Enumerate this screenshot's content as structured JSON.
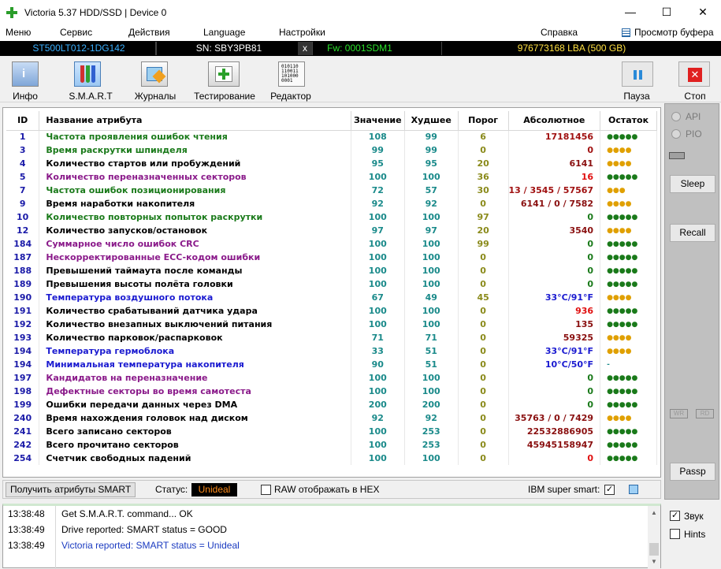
{
  "window": {
    "title": "Victoria 5.37 HDD/SSD | Device 0",
    "min": "—",
    "max": "☐",
    "close": "✕"
  },
  "menu": {
    "items": [
      "Меню",
      "Сервис",
      "Действия",
      "Language",
      "Настройки",
      "Справка"
    ],
    "buffer_viewer": "Просмотр буфера"
  },
  "device": {
    "model": "ST500LT012-1DG142",
    "serial": "SN: SBY3PB81",
    "x": "x",
    "firmware": "Fw: 0001SDM1",
    "lba": "976773168 LBA (500 GB)"
  },
  "toolbar": {
    "info": "Инфо",
    "smart": "S.M.A.R.T",
    "logs": "Журналы",
    "testing": "Тестирование",
    "editor": "Редактор",
    "pause": "Пауза",
    "stop": "Стоп"
  },
  "table": {
    "headers": {
      "id": "ID",
      "name": "Название атрибута",
      "value": "Значение",
      "worst": "Худшее",
      "threshold": "Порог",
      "absolute": "Абсолютное",
      "remain": "Остаток"
    },
    "rows": [
      {
        "id": "1",
        "name": "Частота проявления ошибок чтения",
        "value": "108",
        "worst": "99",
        "thr": "6",
        "abs": "17181456",
        "rem": "●●●●●",
        "nc": "#1a7a1a",
        "ac": "#a01010",
        "rc": "#1a7a1a"
      },
      {
        "id": "3",
        "name": "Время раскрутки шпинделя",
        "value": "99",
        "worst": "99",
        "thr": "0",
        "abs": "0",
        "rem": "●●●●",
        "nc": "#1a7a1a",
        "ac": "#a01010",
        "rc": "#e0a000"
      },
      {
        "id": "4",
        "name": "Количество стартов или пробуждений",
        "value": "95",
        "worst": "95",
        "thr": "20",
        "abs": "6141",
        "rem": "●●●●",
        "nc": "#000000",
        "ac": "#8a1010",
        "rc": "#e0a000"
      },
      {
        "id": "5",
        "name": "Количество переназначенных секторов",
        "value": "100",
        "worst": "100",
        "thr": "36",
        "abs": "16",
        "rem": "●●●●●",
        "nc": "#8a1a8a",
        "ac": "#e01010",
        "rc": "#1a7a1a"
      },
      {
        "id": "7",
        "name": "Частота ошибок позиционирования",
        "value": "72",
        "worst": "57",
        "thr": "30",
        "abs": "13 / 3545 / 57567",
        "rem": "●●●",
        "nc": "#1a7a1a",
        "ac": "#a01010",
        "rc": "#e0a000"
      },
      {
        "id": "9",
        "name": "Время наработки накопителя",
        "value": "92",
        "worst": "92",
        "thr": "0",
        "abs": "6141 / 0 / 7582",
        "rem": "●●●●",
        "nc": "#000000",
        "ac": "#8a1010",
        "rc": "#e0a000"
      },
      {
        "id": "10",
        "name": "Количество повторных попыток раскрутки",
        "value": "100",
        "worst": "100",
        "thr": "97",
        "abs": "0",
        "rem": "●●●●●",
        "nc": "#1a7a1a",
        "ac": "#1a7a1a",
        "rc": "#1a7a1a"
      },
      {
        "id": "12",
        "name": "Количество запусков/остановок",
        "value": "97",
        "worst": "97",
        "thr": "20",
        "abs": "3540",
        "rem": "●●●●",
        "nc": "#000000",
        "ac": "#8a1010",
        "rc": "#e0a000"
      },
      {
        "id": "184",
        "name": "Суммарное число ошибок CRC",
        "value": "100",
        "worst": "100",
        "thr": "99",
        "abs": "0",
        "rem": "●●●●●",
        "nc": "#8a1a8a",
        "ac": "#1a7a1a",
        "rc": "#1a7a1a"
      },
      {
        "id": "187",
        "name": "Нескорректированные ECC-кодом ошибки",
        "value": "100",
        "worst": "100",
        "thr": "0",
        "abs": "0",
        "rem": "●●●●●",
        "nc": "#8a1a8a",
        "ac": "#1a7a1a",
        "rc": "#1a7a1a"
      },
      {
        "id": "188",
        "name": "Превышений таймаута после команды",
        "value": "100",
        "worst": "100",
        "thr": "0",
        "abs": "0",
        "rem": "●●●●●",
        "nc": "#000000",
        "ac": "#1a7a1a",
        "rc": "#1a7a1a"
      },
      {
        "id": "189",
        "name": "Превышения высоты полёта головки",
        "value": "100",
        "worst": "100",
        "thr": "0",
        "abs": "0",
        "rem": "●●●●●",
        "nc": "#000000",
        "ac": "#1a7a1a",
        "rc": "#1a7a1a"
      },
      {
        "id": "190",
        "name": "Температура воздушного потока",
        "value": "67",
        "worst": "49",
        "thr": "45",
        "abs": "33°C/91°F",
        "rem": "●●●●",
        "nc": "#1a1ad0",
        "ac": "#1a1ad0",
        "rc": "#e0a000"
      },
      {
        "id": "191",
        "name": "Количество срабатываний датчика удара",
        "value": "100",
        "worst": "100",
        "thr": "0",
        "abs": "936",
        "rem": "●●●●●",
        "nc": "#000000",
        "ac": "#e01010",
        "rc": "#1a7a1a"
      },
      {
        "id": "192",
        "name": "Количество внезапных выключений питания",
        "value": "100",
        "worst": "100",
        "thr": "0",
        "abs": "135",
        "rem": "●●●●●",
        "nc": "#000000",
        "ac": "#8a1010",
        "rc": "#1a7a1a"
      },
      {
        "id": "193",
        "name": "Количество парковок/распарковок",
        "value": "71",
        "worst": "71",
        "thr": "0",
        "abs": "59325",
        "rem": "●●●●",
        "nc": "#000000",
        "ac": "#8a1010",
        "rc": "#e0a000"
      },
      {
        "id": "194",
        "name": "Температура гермоблока",
        "value": "33",
        "worst": "51",
        "thr": "0",
        "abs": "33°C/91°F",
        "rem": "●●●●",
        "nc": "#1a1ad0",
        "ac": "#1a1ad0",
        "rc": "#e0a000"
      },
      {
        "id": "194",
        "name": "Минимальная температура накопителя",
        "value": "90",
        "worst": "51",
        "thr": "0",
        "abs": "10°C/50°F",
        "rem": "-",
        "nc": "#1a1ad0",
        "ac": "#1a1ad0",
        "rc": "#1a8a8a"
      },
      {
        "id": "197",
        "name": "Кандидатов на переназначение",
        "value": "100",
        "worst": "100",
        "thr": "0",
        "abs": "0",
        "rem": "●●●●●",
        "nc": "#8a1a8a",
        "ac": "#1a7a1a",
        "rc": "#1a7a1a"
      },
      {
        "id": "198",
        "name": "Дефектные секторы во время самотеста",
        "value": "100",
        "worst": "100",
        "thr": "0",
        "abs": "0",
        "rem": "●●●●●",
        "nc": "#8a1a8a",
        "ac": "#1a7a1a",
        "rc": "#1a7a1a"
      },
      {
        "id": "199",
        "name": "Ошибки передачи данных через DMA",
        "value": "200",
        "worst": "200",
        "thr": "0",
        "abs": "0",
        "rem": "●●●●●",
        "nc": "#000000",
        "ac": "#1a7a1a",
        "rc": "#1a7a1a"
      },
      {
        "id": "240",
        "name": "Время нахождения головок над диском",
        "value": "92",
        "worst": "92",
        "thr": "0",
        "abs": "35763 / 0 / 7429",
        "rem": "●●●●",
        "nc": "#000000",
        "ac": "#8a1010",
        "rc": "#e0a000"
      },
      {
        "id": "241",
        "name": "Всего записано секторов",
        "value": "100",
        "worst": "253",
        "thr": "0",
        "abs": "22532886905",
        "rem": "●●●●●",
        "nc": "#000000",
        "ac": "#8a1010",
        "rc": "#1a7a1a"
      },
      {
        "id": "242",
        "name": "Всего прочитано секторов",
        "value": "100",
        "worst": "253",
        "thr": "0",
        "abs": "45945158947",
        "rem": "●●●●●",
        "nc": "#000000",
        "ac": "#8a1010",
        "rc": "#1a7a1a"
      },
      {
        "id": "254",
        "name": "Счетчик свободных падений",
        "value": "100",
        "worst": "100",
        "thr": "0",
        "abs": "0",
        "rem": "●●●●●",
        "nc": "#000000",
        "ac": "#e01010",
        "rc": "#1a7a1a"
      }
    ]
  },
  "bottom": {
    "get_attrs": "Получить атрибуты SMART",
    "status_label": "Статус:",
    "status_value": "Unideal",
    "raw_hex": "RAW отображать в HEX",
    "ibm": "IBM super smart:"
  },
  "log": [
    {
      "time": "13:38:48",
      "msg": "Get S.M.A.R.T. command... OK",
      "color": "#000000"
    },
    {
      "time": "13:38:49",
      "msg": "Drive reported: SMART status = GOOD",
      "color": "#000000"
    },
    {
      "time": "13:38:49",
      "msg": "Victoria reported: SMART status = Unideal",
      "color": "#1a3ac0"
    }
  ],
  "side": {
    "api": "API",
    "pio": "PIO",
    "sleep": "Sleep",
    "recall": "Recall",
    "passp": "Passp",
    "wr": "WR",
    "rd": "RD",
    "sound": "Звук",
    "hints": "Hints"
  }
}
